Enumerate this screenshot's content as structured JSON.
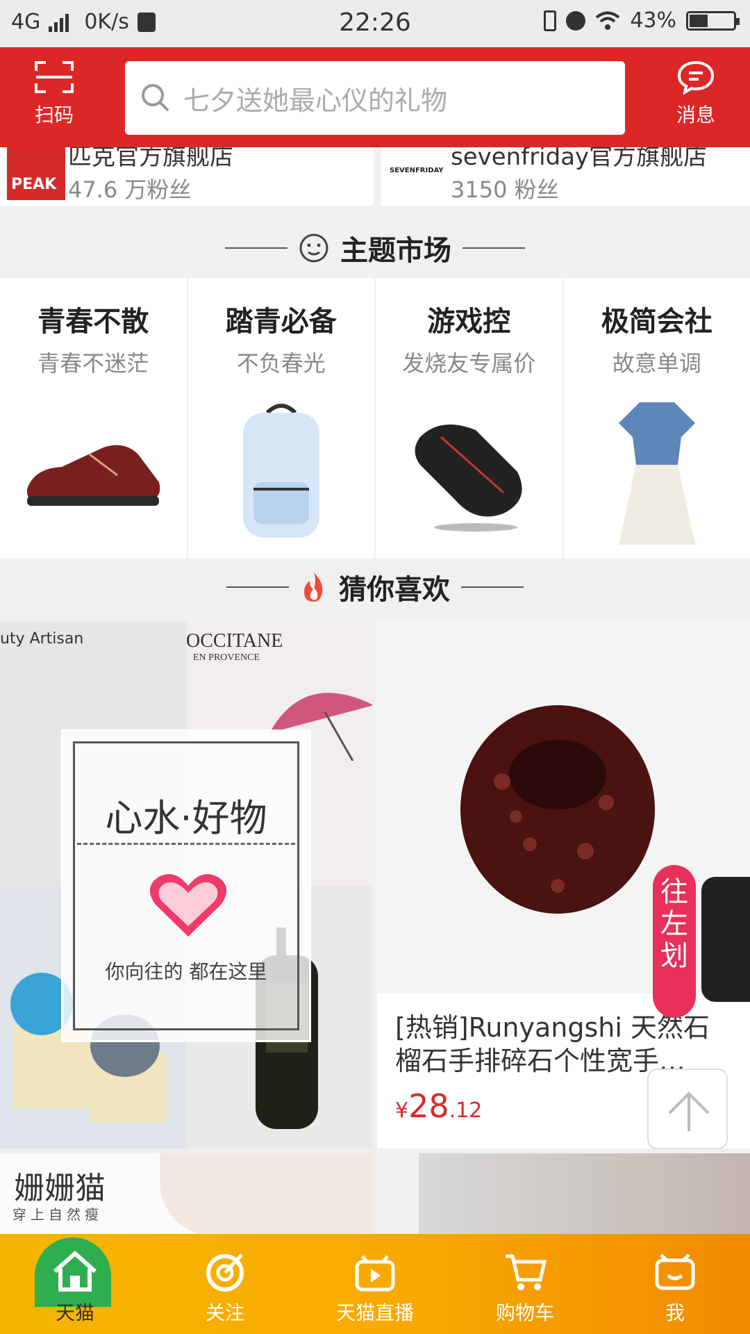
{
  "status_bar": {
    "network": "4G",
    "speed": "0K/s",
    "time": "22:26",
    "battery": "43%"
  },
  "header": {
    "scan_label": "扫码",
    "search_placeholder": "七夕送她最心仪的礼物",
    "message_label": "消息"
  },
  "stores": [
    {
      "logo_text": "PEAK",
      "name": "匹克官方旗舰店",
      "fans": "47.6 万粉丝"
    },
    {
      "logo_text": "SEVENFRIDAY",
      "name": "sevenfriday官方旗舰店",
      "fans": "3150 粉丝"
    }
  ],
  "theme_section": {
    "title": "主题市场",
    "items": [
      {
        "title": "青春不散",
        "subtitle": "青春不迷茫"
      },
      {
        "title": "踏青必备",
        "subtitle": "不负春光"
      },
      {
        "title": "游戏控",
        "subtitle": "发烧友专属价"
      },
      {
        "title": "极简会社",
        "subtitle": "故意单调"
      }
    ]
  },
  "guess_section": {
    "title": "猜你喜欢"
  },
  "promo": {
    "brand_text": "uty Artisan",
    "occitane": "OCCITANE",
    "occitane_sub": "EN PROVENCE",
    "frame_title": "心水·好物",
    "frame_sub": "你向往的  都在这里"
  },
  "product": {
    "title": "[热销]Runyangshi 天然石榴石手排碎石个性宽手…",
    "price_currency": "¥",
    "price_int": "28",
    "price_dec": ".12"
  },
  "swipe_hint": "往左划",
  "bottom_row": {
    "left_text": "姗姗猫",
    "left_sub": "穿上自然瘦"
  },
  "tabbar": [
    {
      "label": "天猫",
      "icon": "home-icon"
    },
    {
      "label": "关注",
      "icon": "follow-icon"
    },
    {
      "label": "天猫直播",
      "icon": "live-icon"
    },
    {
      "label": "购物车",
      "icon": "cart-icon"
    },
    {
      "label": "我",
      "icon": "profile-icon"
    }
  ],
  "colors": {
    "brand_red": "#dd2727",
    "tabbar_orange": "#f7b500",
    "active_green": "#2fae4f"
  }
}
